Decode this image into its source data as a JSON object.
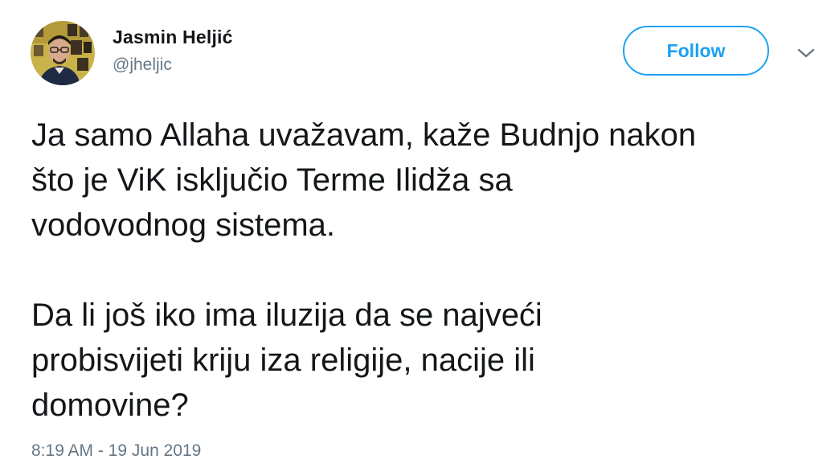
{
  "author": {
    "display_name": "Jasmin Heljić",
    "handle": "@jheljic",
    "avatar": "avatar-photo"
  },
  "actions": {
    "follow_label": "Follow",
    "menu_icon": "chevron-down-icon"
  },
  "tweet": {
    "paragraphs": [
      "Ja samo Allaha uvažavam, kaže Budnjo nakon\nšto je ViK isključio Terme Ilidža sa\nvodovodnog sistema.",
      "Da li još iko ima iluzija da se najveći\nprobisvijeti kriju iza religije, nacije ili\ndomovine?"
    ],
    "timestamp": "8:19 AM - 19 Jun 2019"
  },
  "colors": {
    "accent": "#1da1f2",
    "text": "#14171a",
    "secondary": "#657786"
  }
}
